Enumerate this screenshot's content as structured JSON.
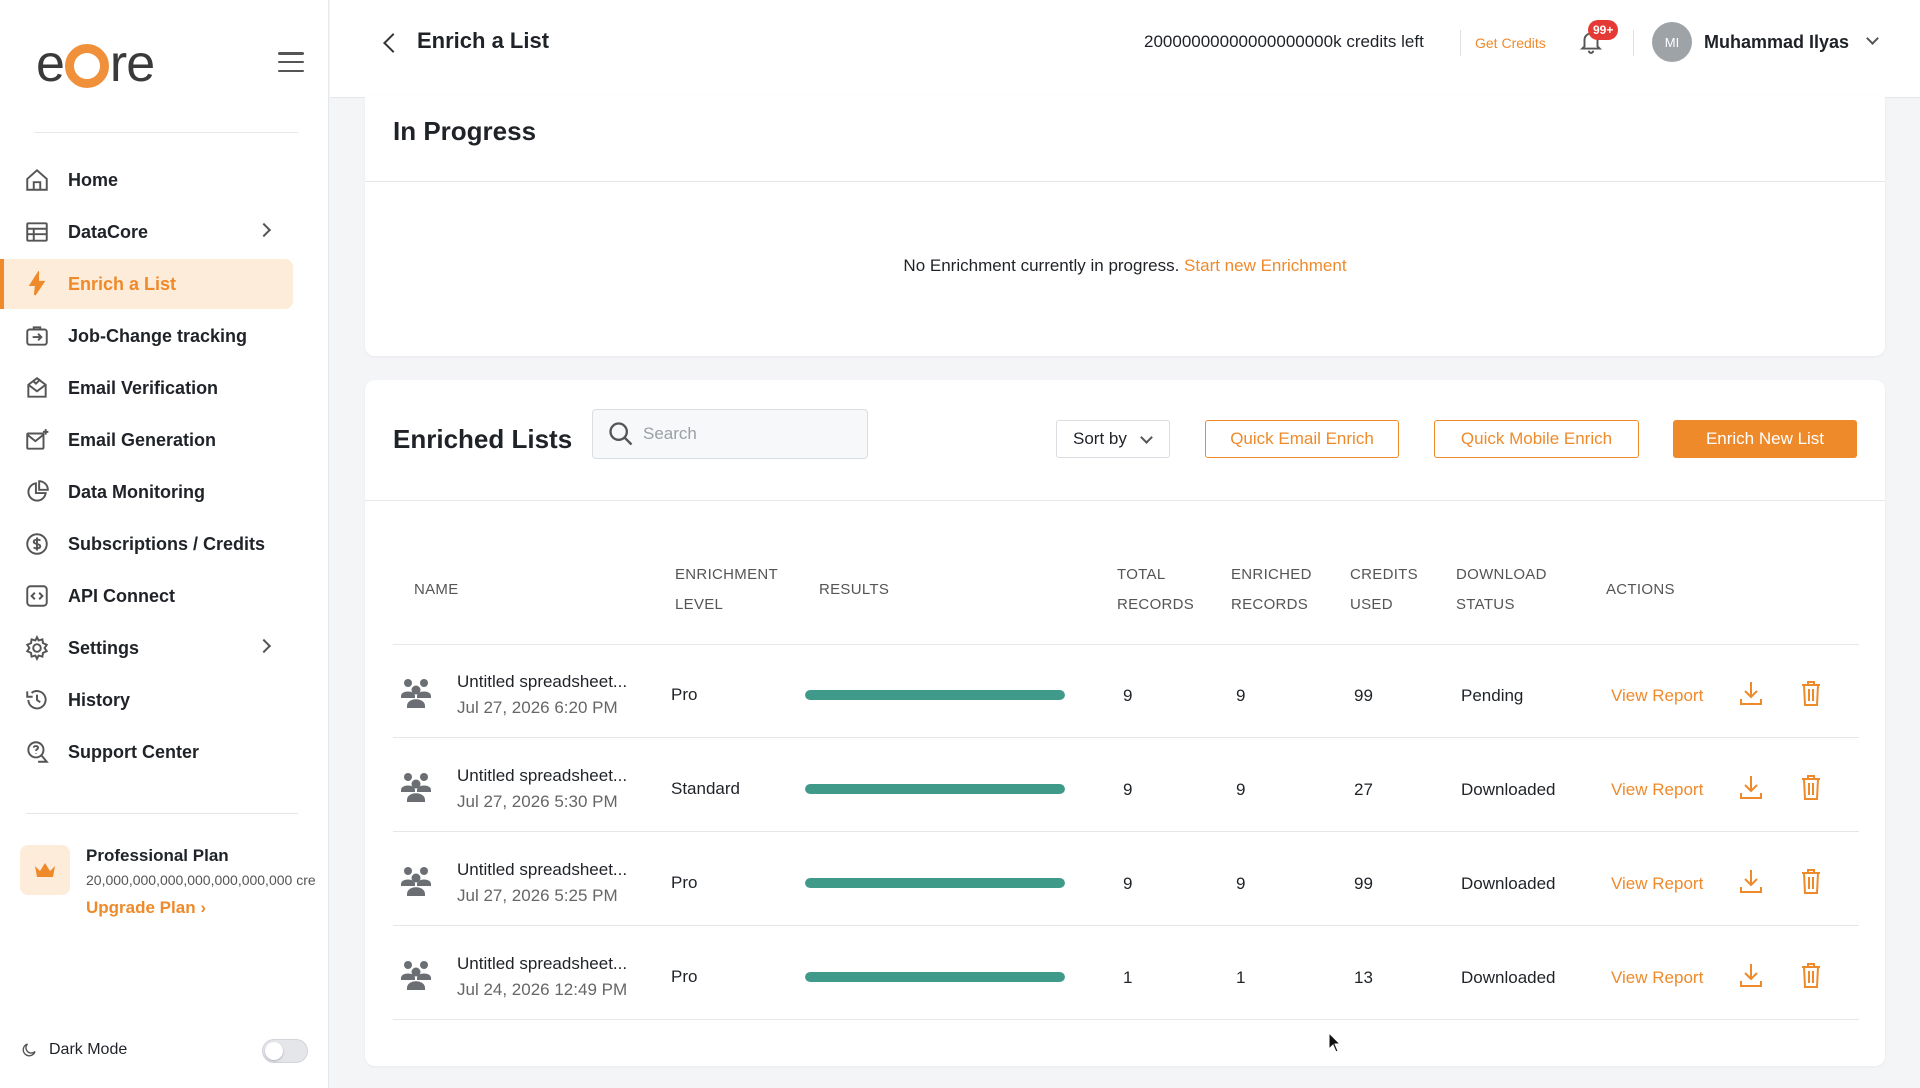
{
  "sidebar": {
    "logo": {
      "pre": "e",
      "post": "re"
    },
    "items": [
      {
        "label": "Home",
        "icon": "home-icon",
        "active": false,
        "chevron": false
      },
      {
        "label": "DataCore",
        "icon": "table-icon",
        "active": false,
        "chevron": true
      },
      {
        "label": "Enrich a List",
        "icon": "lightning-icon",
        "active": true,
        "chevron": false
      },
      {
        "label": "Job-Change tracking",
        "icon": "job-change-icon",
        "active": false,
        "chevron": false
      },
      {
        "label": "Email Verification",
        "icon": "email-verify-icon",
        "active": false,
        "chevron": false
      },
      {
        "label": "Email Generation",
        "icon": "email-generate-icon",
        "active": false,
        "chevron": false
      },
      {
        "label": "Data Monitoring",
        "icon": "pie-chart-icon",
        "active": false,
        "chevron": false
      },
      {
        "label": "Subscriptions / Credits",
        "icon": "dollar-icon",
        "active": false,
        "chevron": false
      },
      {
        "label": "API Connect",
        "icon": "code-icon",
        "active": false,
        "chevron": false
      },
      {
        "label": "Settings",
        "icon": "gear-icon",
        "active": false,
        "chevron": true
      },
      {
        "label": "History",
        "icon": "history-icon",
        "active": false,
        "chevron": false
      },
      {
        "label": "Support Center",
        "icon": "support-icon",
        "active": false,
        "chevron": false
      }
    ],
    "plan": {
      "title": "Professional Plan",
      "credits": "20,000,000,000,000,000,000,000 cre",
      "upgrade": "Upgrade Plan"
    },
    "dark_mode": {
      "label": "Dark Mode",
      "enabled": false
    }
  },
  "header": {
    "title": "Enrich a List",
    "credits_left": "20000000000000000000k credits left",
    "get_credits": "Get Credits",
    "notification_badge": "99+",
    "user_initials": "MI",
    "user_name": "Muhammad Ilyas"
  },
  "in_progress": {
    "title": "In Progress",
    "empty_message": "No Enrichment currently in progress.",
    "empty_link": "Start new Enrichment"
  },
  "enriched_lists": {
    "title": "Enriched Lists",
    "search_placeholder": "Search",
    "sort_label": "Sort by",
    "quick_email": "Quick Email Enrich",
    "quick_mobile": "Quick Mobile Enrich",
    "enrich_new": "Enrich New List",
    "columns": {
      "name": "NAME",
      "level_1": "ENRICHMENT",
      "level_2": "LEVEL",
      "results": "RESULTS",
      "total_1": "TOTAL",
      "total_2": "RECORDS",
      "enriched_1": "ENRICHED",
      "enriched_2": "RECORDS",
      "credits_1": "CREDITS",
      "credits_2": "USED",
      "download_1": "DOWNLOAD",
      "download_2": "STATUS",
      "actions": "ACTIONS"
    },
    "rows": [
      {
        "name": "Untitled spreadsheet...",
        "date": "Jul 27, 2026 6:20 PM",
        "level": "Pro",
        "progress": 1.0,
        "total": "9",
        "enriched": "9",
        "credits": "99",
        "status": "Pending",
        "view": "View Report"
      },
      {
        "name": "Untitled spreadsheet...",
        "date": "Jul 27, 2026 5:30 PM",
        "level": "Standard",
        "progress": 1.0,
        "total": "9",
        "enriched": "9",
        "credits": "27",
        "status": "Downloaded",
        "view": "View Report"
      },
      {
        "name": "Untitled spreadsheet...",
        "date": "Jul 27, 2026 5:25 PM",
        "level": "Pro",
        "progress": 1.0,
        "total": "9",
        "enriched": "9",
        "credits": "99",
        "status": "Downloaded",
        "view": "View Report"
      },
      {
        "name": "Untitled spreadsheet...",
        "date": "Jul 24, 2026 12:49 PM",
        "level": "Pro",
        "progress": 1.0,
        "total": "1",
        "enriched": "1",
        "credits": "13",
        "status": "Downloaded",
        "view": "View Report"
      }
    ]
  },
  "colors": {
    "accent": "#ef8a2b",
    "progress": "#3f9a8a",
    "badge": "#e53935"
  }
}
